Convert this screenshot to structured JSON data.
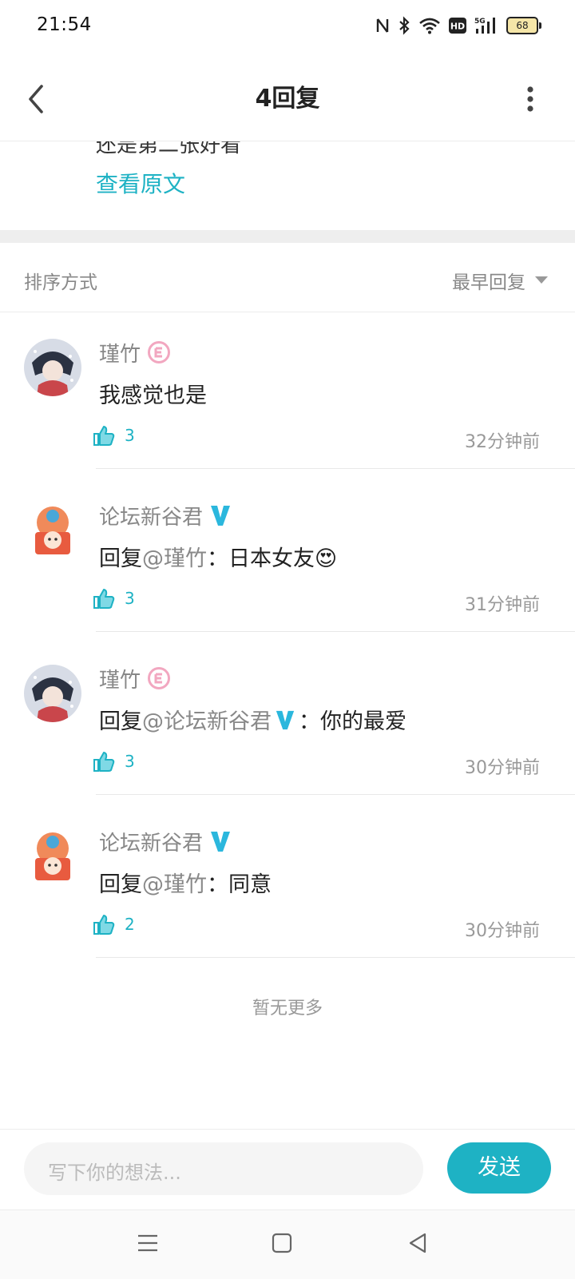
{
  "status_bar": {
    "time": "21:54",
    "battery": "68",
    "icons": [
      "nfc-icon",
      "bluetooth-icon",
      "wifi-icon",
      "hd-icon",
      "5g-signal-icon",
      "battery-icon"
    ]
  },
  "header": {
    "title": "4回复"
  },
  "original_post": {
    "preview_text": "还是第二张好看",
    "view_original_label": "查看原文"
  },
  "sort_bar": {
    "label": "排序方式",
    "value": "最早回复"
  },
  "replies": [
    {
      "name": "瑾竹",
      "badge": "level-badge",
      "prefix": "",
      "mention": "",
      "text": "我感觉也是",
      "likes": "3",
      "time": "32分钟前"
    },
    {
      "name": "论坛新谷君",
      "badge": "verified-v",
      "prefix": "回复",
      "mention": "@瑾竹",
      "text": "：日本女友😍",
      "likes": "3",
      "time": "31分钟前"
    },
    {
      "name": "瑾竹",
      "badge": "level-badge",
      "prefix": "回复",
      "mention": "@论坛新谷君",
      "text": "：你的最爱",
      "likes": "3",
      "time": "30分钟前"
    },
    {
      "name": "论坛新谷君",
      "badge": "verified-v",
      "prefix": "回复",
      "mention": "@瑾竹",
      "text": "：同意",
      "likes": "2",
      "time": "30分钟前"
    }
  ],
  "footer_note": "暂无更多",
  "composer": {
    "placeholder": "写下你的想法...",
    "send_label": "发送"
  },
  "colors": {
    "accent": "#1eb2c4",
    "verified": "#2bb7dd",
    "badge_pink": "#f2a7c0"
  }
}
